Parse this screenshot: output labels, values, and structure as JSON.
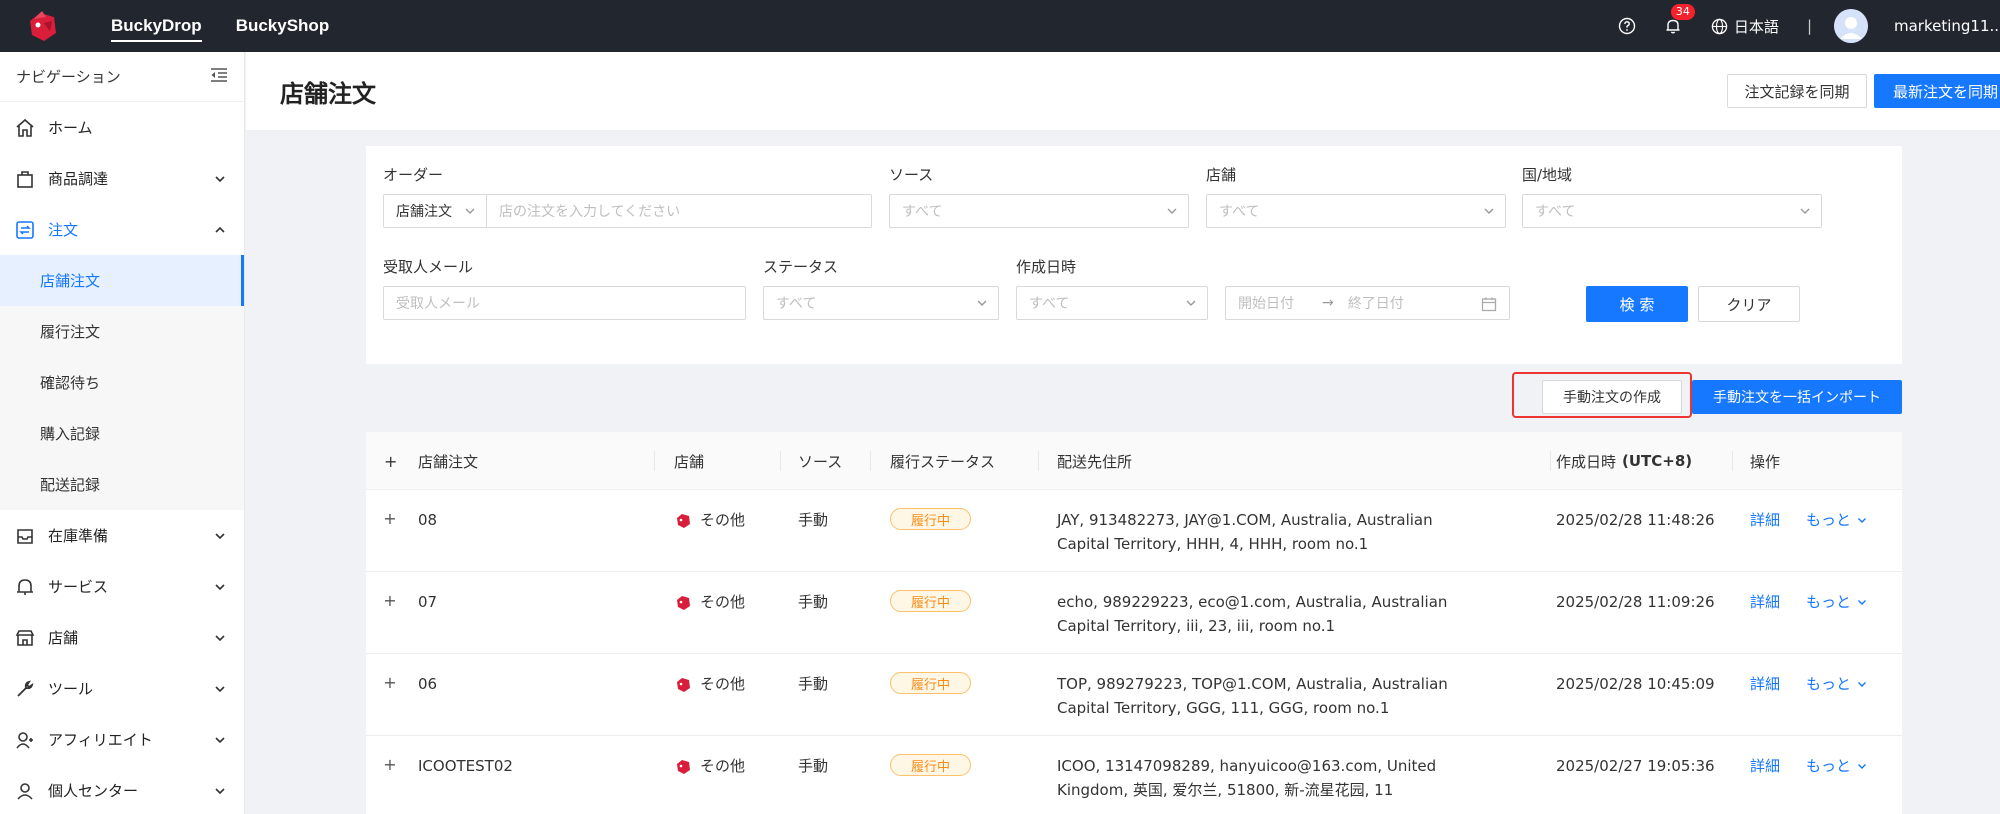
{
  "topbar": {
    "tabs": [
      {
        "label": "BuckyDrop"
      },
      {
        "label": "BuckyShop"
      }
    ],
    "notification_count": "34",
    "language": "日本語",
    "separator": "|",
    "username": "marketing11..."
  },
  "sidebar": {
    "header": "ナビゲーション",
    "items": [
      {
        "label": "ホーム",
        "icon": "home-icon"
      },
      {
        "label": "商品調達",
        "icon": "bag-icon"
      },
      {
        "label": "注文",
        "icon": "order-icon"
      },
      {
        "label": "在庫準備",
        "icon": "inbox-icon"
      },
      {
        "label": "サービス",
        "icon": "bell-service-icon"
      },
      {
        "label": "店舗",
        "icon": "store-icon"
      },
      {
        "label": "ツール",
        "icon": "wrench-icon"
      },
      {
        "label": "アフィリエイト",
        "icon": "affiliate-icon"
      },
      {
        "label": "個人センター",
        "icon": "user-icon"
      }
    ],
    "sub_items": [
      {
        "label": "店舗注文"
      },
      {
        "label": "履行注文"
      },
      {
        "label": "確認待ち"
      },
      {
        "label": "購入記録"
      },
      {
        "label": "配送記録"
      }
    ]
  },
  "page": {
    "title": "店舗注文",
    "sync_button": "注文記録を同期",
    "sync_latest_button": "最新注文を同期"
  },
  "filters": {
    "order_label": "オーダー",
    "order_type": "店舗注文",
    "order_placeholder": "店の注文を入力してください",
    "source_label": "ソース",
    "source_value": "すべて",
    "store_label": "店舗",
    "store_value": "すべて",
    "country_label": "国/地域",
    "country_value": "すべて",
    "email_label": "受取人メール",
    "email_placeholder": "受取人メール",
    "status_label": "ステータス",
    "status_value": "すべて",
    "created_label": "作成日時",
    "created_value": "すべて",
    "start_date": "開始日付",
    "end_date": "終了日付",
    "date_arrow": "→",
    "search_button": "検 索",
    "clear_button": "クリア"
  },
  "actions": {
    "manual_create": "手動注文の作成",
    "bulk_import": "手動注文を一括インポート"
  },
  "table": {
    "columns": {
      "expand": "+",
      "order": "店舗注文",
      "store": "店舗",
      "source": "ソース",
      "status": "履行ステータス",
      "address": "配送先住所",
      "created_prefix": "作成日時 ",
      "created_tz": "(UTC+8)",
      "actions": "操作"
    },
    "rows": [
      {
        "expand": "+",
        "order": "08",
        "store": "その他",
        "source": "手動",
        "status": "履行中",
        "address_line1": "JAY, 913482273, JAY@1.COM, Australia, Australian",
        "address_line2": "Capital Territory, HHH, 4, HHH, room no.1",
        "created": "2025/02/28 11:48:26",
        "detail": "詳細",
        "more": "もっと"
      },
      {
        "expand": "+",
        "order": "07",
        "store": "その他",
        "source": "手動",
        "status": "履行中",
        "address_line1": "echo, 989229223, eco@1.com, Australia, Australian",
        "address_line2": "Capital Territory, iii, 23, iii, room no.1",
        "created": "2025/02/28 11:09:26",
        "detail": "詳細",
        "more": "もっと"
      },
      {
        "expand": "+",
        "order": "06",
        "store": "その他",
        "source": "手動",
        "status": "履行中",
        "address_line1": "TOP, 989279223, TOP@1.COM, Australia, Australian",
        "address_line2": "Capital Territory, GGG, 111, GGG, room no.1",
        "created": "2025/02/28 10:45:09",
        "detail": "詳細",
        "more": "もっと"
      },
      {
        "expand": "+",
        "order": "ICOOTEST02",
        "store": "その他",
        "source": "手動",
        "status": "履行中",
        "address_line1": "ICOO, 13147098289, hanyuicoo@163.com, United",
        "address_line2": "Kingdom, 英国, 爱尔兰, 51800, 新-流星花园, 11",
        "created": "2025/02/27 19:05:36",
        "detail": "詳細",
        "more": "もっと"
      }
    ]
  },
  "colors": {
    "accent": "#1677ff",
    "topbar": "#22262e",
    "warning": "#fa8c16",
    "highlight": "#ee3333"
  }
}
